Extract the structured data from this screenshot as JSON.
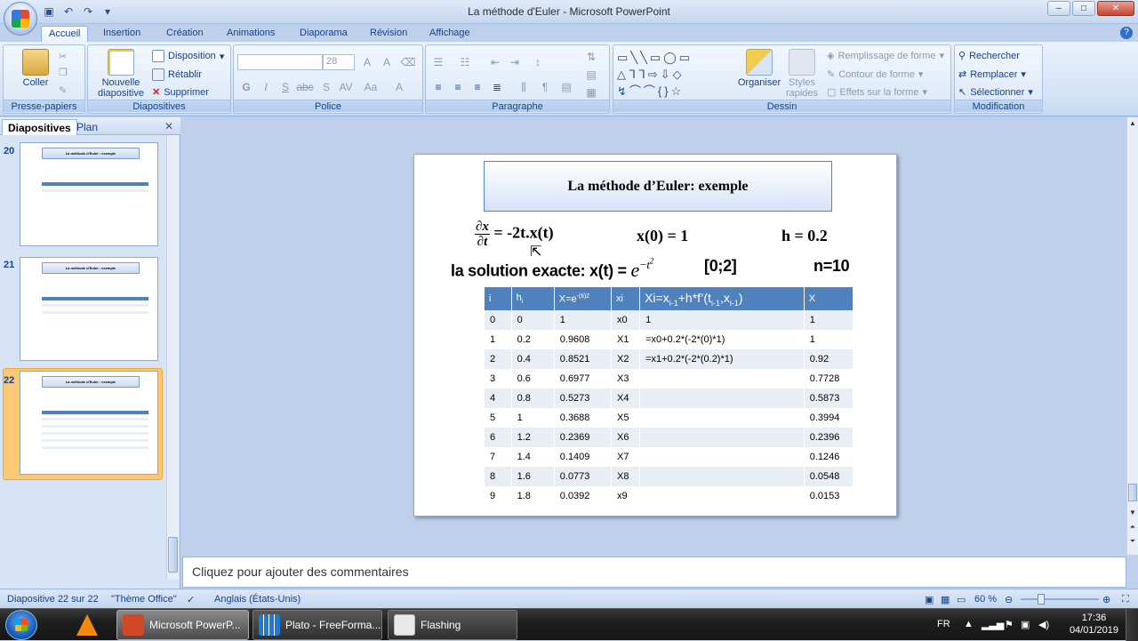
{
  "window": {
    "title": "La méthode d'Euler - Microsoft PowerPoint",
    "controls": [
      "–",
      "□",
      "✕"
    ]
  },
  "ribbon_tabs": [
    "Accueil",
    "Insertion",
    "Création",
    "Animations",
    "Diaporama",
    "Révision",
    "Affichage"
  ],
  "ribbon": {
    "presse_papiers": {
      "coller": "Coller",
      "label": "Presse-papiers"
    },
    "diapositives": {
      "nouvelle": "Nouvelle diapositive",
      "disposition": "Disposition",
      "retablir": "Rétablir",
      "supprimer": "Supprimer",
      "label": "Diapositives"
    },
    "police": {
      "font_size": "28",
      "label": "Police"
    },
    "paragraphe": {
      "label": "Paragraphe"
    },
    "dessin": {
      "organiser": "Organiser",
      "styles_rapides": "Styles rapides",
      "remplissage": "Remplissage de forme",
      "contour": "Contour de forme",
      "effets": "Effets sur la forme",
      "label": "Dessin"
    },
    "modification": {
      "rechercher": "Rechercher",
      "remplacer": "Remplacer",
      "selectionner": "Sélectionner",
      "label": "Modification"
    }
  },
  "left_panel": {
    "tabs": [
      "Diapositives",
      "Plan"
    ],
    "thumbs": [
      {
        "num": "20",
        "title": "La méthode d'Euler : exemple"
      },
      {
        "num": "21",
        "title": "La méthode d'Euler : exemple"
      },
      {
        "num": "22",
        "title": "La méthode d'Euler : exemple"
      }
    ]
  },
  "slide": {
    "title": "La méthode d’Euler: exemple",
    "eq_num": "∂x",
    "eq_den": "∂t",
    "eq_rhs": "= -2t.x(t)",
    "initial": "x(0) = 1",
    "step": "h = 0.2",
    "solution_label": "la solution exacte: x(t) =",
    "interval": "[0;2]",
    "n": "n=10",
    "table": {
      "headers": [
        "i",
        "hi",
        "X=e-(ti)2",
        "xi",
        "Xi=xi-1+h*f’(ti-1,xi-1)",
        "X"
      ],
      "rows": [
        [
          "0",
          "0",
          "1",
          "x0",
          "1",
          "1"
        ],
        [
          "1",
          "0.2",
          "0.9608",
          "X1",
          "=x0+0.2*(-2*(0)*1)",
          "1"
        ],
        [
          "2",
          "0.4",
          "0.8521",
          "X2",
          "=x1+0.2*(-2*(0.2)*1)",
          "0.92"
        ],
        [
          "3",
          "0.6",
          "0.6977",
          "X3",
          "",
          "0.7728"
        ],
        [
          "4",
          "0.8",
          "0.5273",
          "X4",
          "",
          "0.5873"
        ],
        [
          "5",
          "1",
          "0.3688",
          "X5",
          "",
          "0.3994"
        ],
        [
          "6",
          "1.2",
          "0.2369",
          "X6",
          "",
          "0.2396"
        ],
        [
          "7",
          "1.4",
          "0.1409",
          "X7",
          "",
          "0.1246"
        ],
        [
          "8",
          "1.6",
          "0.0773",
          "X8",
          "",
          "0.0548"
        ],
        [
          "9",
          "1.8",
          "0.0392",
          "x9",
          "",
          "0.0153"
        ]
      ]
    }
  },
  "notes": {
    "placeholder": "Cliquez pour ajouter des commentaires"
  },
  "status": {
    "slide": "Diapositive 22 sur 22",
    "theme": "\"Thème Office\"",
    "language": "Anglais (États-Unis)",
    "zoom": "60 %"
  },
  "taskbar": {
    "tasks": [
      "Microsoft PowerP...",
      "Plato - FreeForma...",
      "Flashing"
    ],
    "lang": "FR",
    "time": "17:36",
    "date": "04/01/2019"
  }
}
